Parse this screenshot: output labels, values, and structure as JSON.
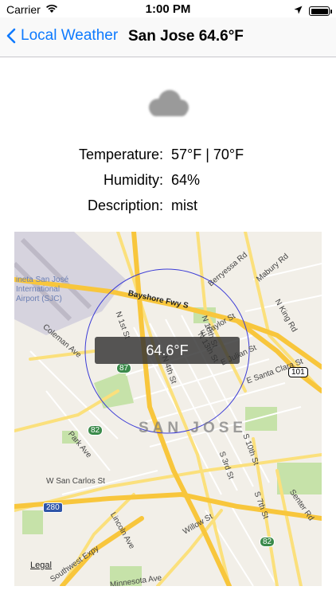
{
  "status_bar": {
    "carrier": "Carrier",
    "time": "1:00 PM"
  },
  "nav": {
    "back_label": "Local Weather",
    "title": "San Jose 64.6°F"
  },
  "weather": {
    "icon": "cloud-icon",
    "temperature_label": "Temperature:",
    "temperature_value": "57°F | 70°F",
    "humidity_label": "Humidity:",
    "humidity_value": "64%",
    "description_label": "Description:",
    "description_value": "mist"
  },
  "map": {
    "overlay_temp": "64.6°F",
    "city_label": "SAN JOSE",
    "legal": "Legal",
    "labels": {
      "airport_1": "ineta San José",
      "airport_2": "International",
      "airport_3": "Airport (SJC)",
      "bayshore": "Bayshore Fwy S",
      "berryessa": "Berryessa Rd",
      "mabury": "Mabury Rd",
      "n_king": "N King Rd",
      "e_taylor": "E Taylor St",
      "n_13th": "N 13th St",
      "e_julian": "E Julian St",
      "santa_clara": "E Santa Clara St",
      "n_1st": "N 1st St",
      "n_4th": "N 4th St",
      "n_10th": "N 10th St",
      "coleman": "Coleman Ave",
      "park_ave": "Park Ave",
      "w_san_carlos": "W San Carlos St",
      "lincoln": "Lincoln Ave",
      "willow": "Willow St",
      "s_3rd": "S 3rd St",
      "s_10th": "S 10th St",
      "s_7th": "S 7th St",
      "senter": "Senter Rd",
      "southwest_expy": "Southwest Expy",
      "minnesota": "Minnesota Ave",
      "shield_87": "87",
      "shield_82_a": "82",
      "shield_82_b": "82",
      "shield_101": "101",
      "shield_280": "280"
    },
    "colors": {
      "freeway": "#f8c63c",
      "arterial": "#fbe07c",
      "radius_circle": "#3b3bd6",
      "park": "#c6e2a9"
    }
  }
}
